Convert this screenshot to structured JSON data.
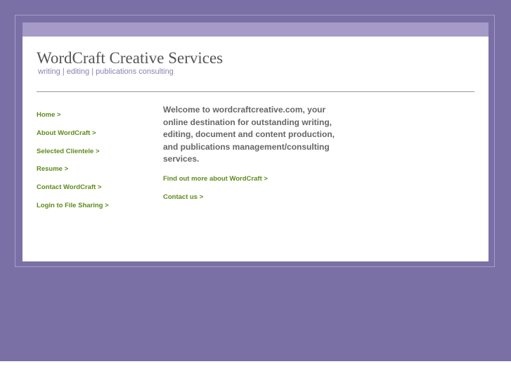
{
  "header": {
    "title": "WordCraft Creative Services",
    "tagline": "writing | editing | publications consulting"
  },
  "nav": {
    "items": [
      {
        "label": "Home >"
      },
      {
        "label": "About WordCraft >"
      },
      {
        "label": "Selected Clientele >"
      },
      {
        "label": "Resume >"
      },
      {
        "label": "Contact WordCraft >"
      },
      {
        "label": "Login to File Sharing >"
      }
    ]
  },
  "content": {
    "welcome": "Welcome to wordcraftcreative.com, your online destination for outstanding writing, editing, document and content production, and publications management/consulting services.",
    "links": [
      {
        "label": "Find out more about WordCraft >"
      },
      {
        "label": "Contact us >"
      }
    ]
  },
  "colors": {
    "background": "#7b70a5",
    "bar": "#a69ac8",
    "link": "#5e8a1c",
    "tagline": "#8a80b4"
  }
}
